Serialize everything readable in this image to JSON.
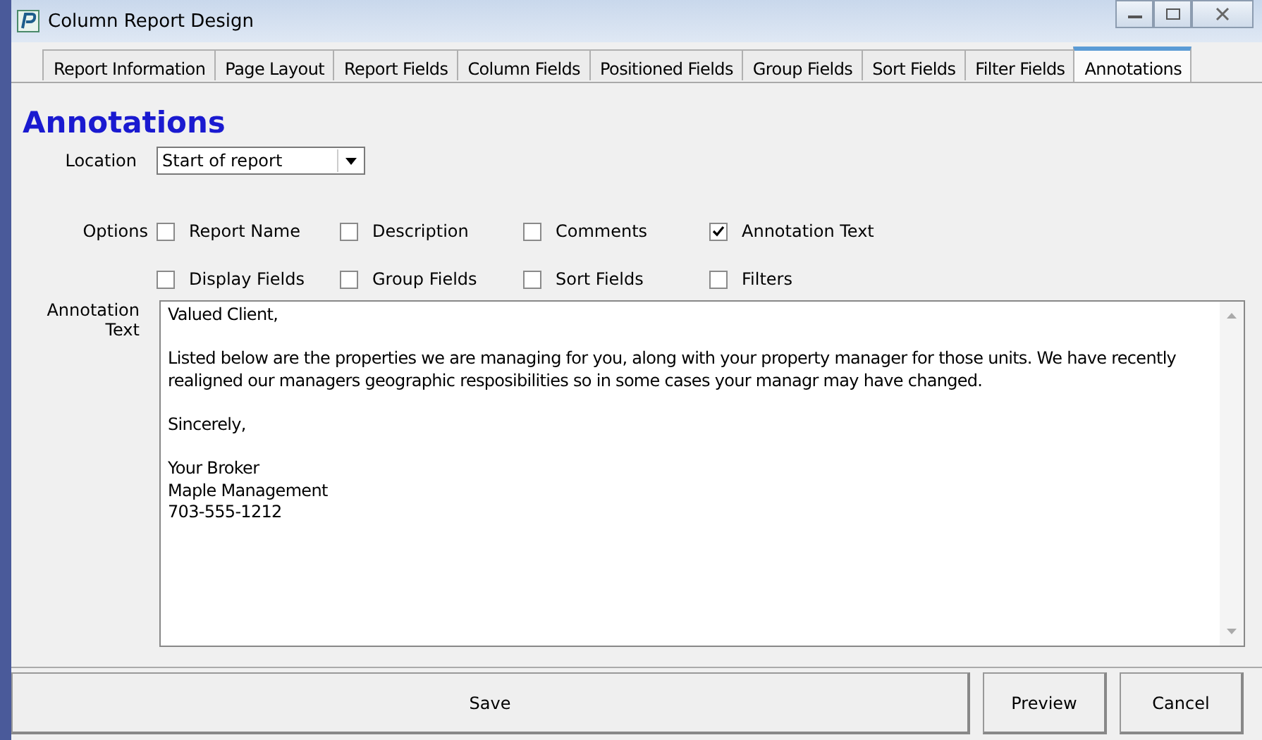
{
  "window": {
    "title": "Column Report Design"
  },
  "tabs": [
    {
      "label": "Report Information",
      "selected": false
    },
    {
      "label": "Page Layout",
      "selected": false
    },
    {
      "label": "Report Fields",
      "selected": false
    },
    {
      "label": "Column Fields",
      "selected": false
    },
    {
      "label": "Positioned Fields",
      "selected": false
    },
    {
      "label": "Group Fields",
      "selected": false
    },
    {
      "label": "Sort Fields",
      "selected": false
    },
    {
      "label": "Filter Fields",
      "selected": false
    },
    {
      "label": "Annotations",
      "selected": true
    }
  ],
  "heading": "Annotations",
  "location": {
    "label": "Location",
    "value": "Start of report"
  },
  "options": {
    "label": "Options",
    "items": [
      {
        "label": "Report Name",
        "checked": false
      },
      {
        "label": "Description",
        "checked": false
      },
      {
        "label": "Comments",
        "checked": false
      },
      {
        "label": "Annotation Text",
        "checked": true
      },
      {
        "label": "Display Fields",
        "checked": false
      },
      {
        "label": "Group Fields",
        "checked": false
      },
      {
        "label": "Sort Fields",
        "checked": false
      },
      {
        "label": "Filters",
        "checked": false
      }
    ]
  },
  "annotation": {
    "label": "Annotation Text",
    "value": "Valued Client,\n\nListed below are the properties we are managing for you, along with your property manager for those units. We have recently realigned our managers geographic resposibilities so in some cases your managr may have changed.\n\nSincerely,\n\nYour Broker\nMaple Management\n703-555-1212"
  },
  "buttons": [
    "Save",
    "Preview",
    "Cancel"
  ]
}
